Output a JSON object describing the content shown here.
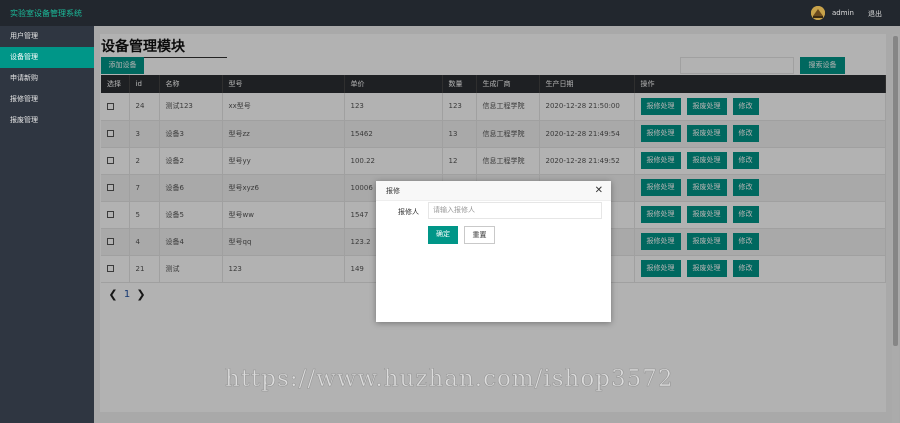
{
  "header": {
    "app_title": "实验室设备管理系统",
    "user_name": "admin",
    "logout_label": "退出"
  },
  "sidebar": {
    "items": [
      {
        "label": "用户管理"
      },
      {
        "label": "设备管理"
      },
      {
        "label": "申请新购"
      },
      {
        "label": "报修管理"
      },
      {
        "label": "报废管理"
      }
    ]
  },
  "main": {
    "module_title": "设备管理模块",
    "add_button": "添加设备",
    "search_placeholder": "",
    "search_button": "搜索设备",
    "table": {
      "headers": [
        "选择",
        "id",
        "名称",
        "型号",
        "单价",
        "数量",
        "生成厂商",
        "生产日期",
        "操作"
      ],
      "rows": [
        {
          "id": "24",
          "name": "测试123",
          "model": "xx型号",
          "price": "123",
          "qty": "123",
          "maker": "信息工程学院",
          "date": "2020-12-28 21:50:00"
        },
        {
          "id": "3",
          "name": "设备3",
          "model": "型号zz",
          "price": "15462",
          "qty": "13",
          "maker": "信息工程学院",
          "date": "2020-12-28 21:49:54"
        },
        {
          "id": "2",
          "name": "设备2",
          "model": "型号yy",
          "price": "100.22",
          "qty": "12",
          "maker": "信息工程学院",
          "date": "2020-12-28 21:49:52"
        },
        {
          "id": "7",
          "name": "设备6",
          "model": "型号xyz6",
          "price": "10006",
          "qty": "",
          "maker": "",
          "date": ""
        },
        {
          "id": "5",
          "name": "设备5",
          "model": "型号ww",
          "price": "1547",
          "qty": "",
          "maker": "",
          "date": ""
        },
        {
          "id": "4",
          "name": "设备4",
          "model": "型号qq",
          "price": "123.2",
          "qty": "",
          "maker": "",
          "date": ""
        },
        {
          "id": "21",
          "name": "测试",
          "model": "123",
          "price": "149",
          "qty": "",
          "maker": "",
          "date": ""
        }
      ],
      "actions": [
        "报修处理",
        "报废处理",
        "修改"
      ]
    },
    "pager": {
      "prev": "❮",
      "current": "1",
      "next": "❯"
    }
  },
  "modal": {
    "title": "报修",
    "close": "✕",
    "field_label": "报修人",
    "field_placeholder": "请输入报修人",
    "field_value": "",
    "ok_label": "确定",
    "reset_label": "重置"
  },
  "watermark": "https://www.huzhan.com/ishop3572",
  "colors": {
    "accent": "#009688",
    "topbar": "#22272e",
    "sidebar": "#2f3641",
    "title_text": "#1bbc9b",
    "table_header": "#2b2e33"
  }
}
